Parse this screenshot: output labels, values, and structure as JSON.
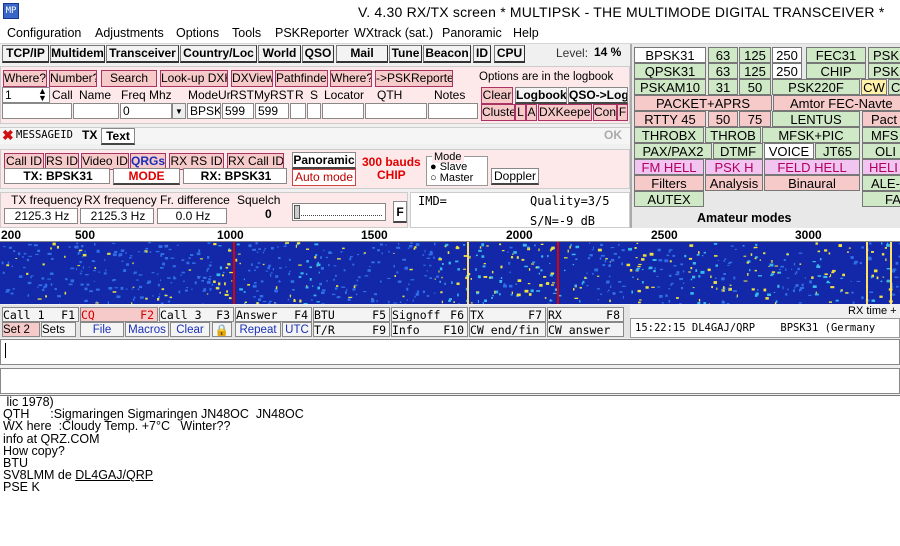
{
  "window": {
    "title": "V. 4.30      RX/TX screen  * MULTIPSK - THE MULTIMODE DIGITAL TRANSCEIVER *",
    "icon_text": "MP"
  },
  "menu": [
    "Configuration",
    "Adjustments",
    "Options",
    "Tools",
    "PSKReporter",
    "WXtrack (sat.)",
    "Panoramic",
    "Help"
  ],
  "toolbar": [
    "TCP/IP",
    "Multidem",
    "Transceiver",
    "Country/Loc",
    "World",
    "QSO",
    "Mail",
    "Tune",
    "Beacon",
    "ID",
    "CPU"
  ],
  "level": {
    "label": "Level:",
    "value": "14 %"
  },
  "logbook": {
    "buttons": [
      "Where?",
      "Number?",
      "Search",
      "Look-up DXK",
      "DXView",
      "Pathfinder",
      "Where?",
      "->PSKReporter"
    ],
    "note": "Options are in the logbook",
    "headers": [
      "Call",
      "Name",
      "Freq Mhz",
      "ModeUr",
      "RSTMy",
      "RST",
      "R",
      "S",
      "Locator",
      "QTH",
      "Notes"
    ],
    "row_index": "1",
    "freq": "0",
    "mode": "BPSK",
    "rst_ur": "599",
    "rst_my": "599",
    "right_buttons": [
      "Clear",
      "Logbook",
      "QSO->Log",
      "Cluster",
      "L",
      "A",
      "DXKeeper",
      "Conf",
      "F"
    ]
  },
  "message_bar": {
    "label": "MESSAGEID",
    "tx": "TX",
    "text": "Text",
    "ok": "OK"
  },
  "id_buttons": [
    "Call ID",
    "RS ID",
    "Video ID",
    "QRGs",
    "RX RS ID",
    "RX Call ID"
  ],
  "panoramic": {
    "button": "Panoramic",
    "bauds": "300 bauds",
    "chip": "CHIP"
  },
  "tx_mode": "TX: BPSK31",
  "mode_button": "MODE",
  "rx_mode": "RX: BPSK31",
  "auto_mode": "Auto mode",
  "mode_group": {
    "label": "Mode",
    "slave": "Slave",
    "master": "Master"
  },
  "doppler": "Doppler",
  "freq_panel": {
    "tx_label": "TX frequency",
    "tx_value": "2125.3 Hz",
    "rx_label": "RX frequency",
    "rx_value": "2125.3 Hz",
    "diff_label": "Fr. difference",
    "diff_value": "0.0 Hz",
    "squelch_label": "Squelch",
    "squelch_value": "0",
    "f": "F"
  },
  "imd": {
    "label": "IMD=",
    "quality": "Quality=3/5",
    "sn": "S/N=-9 dB"
  },
  "modes": [
    [
      "BPSK31",
      "63",
      "125",
      "250",
      "FEC31",
      "PSK"
    ],
    [
      "QPSK31",
      "63",
      "125",
      "250",
      "CHIP",
      "PSK"
    ],
    [
      "PSKAM10",
      "31",
      "50",
      "PSK220F",
      "CW",
      "C"
    ],
    [
      "PACKET+APRS",
      "Amtor FEC-Navte"
    ],
    [
      "RTTY 45",
      "50",
      "75",
      "LENTUS",
      "Pact"
    ],
    [
      "THROBX",
      "THROB",
      "MFSK+PIC",
      "MFS"
    ],
    [
      "PAX/PAX2",
      "DTMF",
      "VOICE",
      "JT65",
      "OLI"
    ],
    [
      "FM HELL",
      "PSK H",
      "FELD HELL",
      "HELI"
    ],
    [
      "Filters",
      "Analysis",
      "Binaural",
      "ALE-"
    ],
    [
      "AUTEX",
      "FA"
    ]
  ],
  "amateur_modes": "Amateur modes",
  "scale": [
    "200",
    "500",
    "1000",
    "1500",
    "2000",
    "2500",
    "3000"
  ],
  "macros_row1": [
    [
      "Call 1",
      "F1"
    ],
    [
      "CQ",
      "F2"
    ],
    [
      "Call 3",
      "F3"
    ],
    [
      "Answer",
      "F4"
    ],
    [
      "BTU",
      "F5"
    ],
    [
      "Signoff",
      "F6"
    ],
    [
      "TX",
      "F7"
    ],
    [
      "RX",
      "F8"
    ]
  ],
  "macros_row2": [
    "Set 2",
    "Sets",
    "File",
    "Macros",
    "Clear",
    "Repeat",
    "UTC",
    [
      "T/R",
      "F9"
    ],
    [
      "Info",
      "F10"
    ],
    "CW end/fin",
    "CW answer"
  ],
  "rx_time_label": "RX time + c",
  "log_line": "15:22:15 DL4GAJ/QRP    BPSK31 (Germany",
  "rx_text": [
    " lic 1978)",
    "QTH      :Sigmaringen Sigmaringen JN48OC  JN48OC",
    "",
    "WX here  :Cloudy Temp. +7°C   Winter??",
    "",
    "info at QRZ.COM",
    "How copy?",
    "BTU"
  ],
  "rx_call_prefix": "SV8LMM de ",
  "rx_call": "DL4GAJ/QRP",
  "rx_last": "PSE K",
  "colors": {
    "pink": "#f7caca",
    "green": "#cfe8c6",
    "waterfall": "#1228a8",
    "red": "#e00000"
  }
}
